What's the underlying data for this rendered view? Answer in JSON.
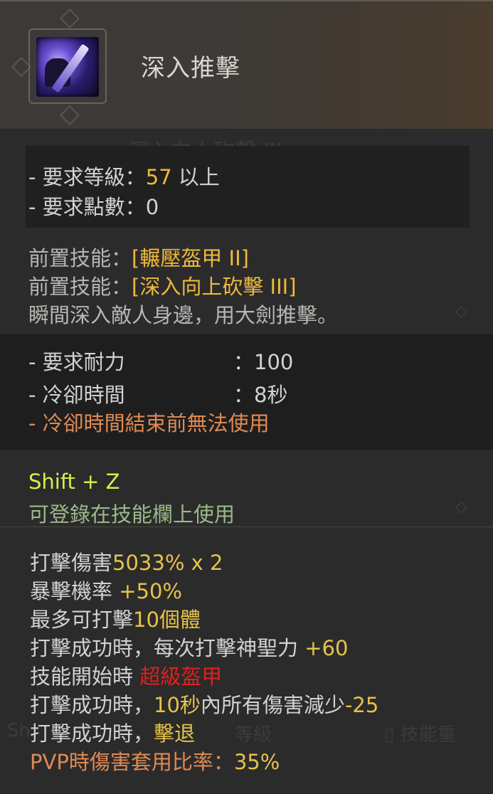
{
  "skill": {
    "name": "深入推擊",
    "icon": "skill-icon-greatsword-thrust"
  },
  "background_ghost": {
    "prev_skill": "深入向上砍擊 III",
    "bottom_left": "Sh",
    "bottom_mid": "等級",
    "bottom_right": "技能重"
  },
  "requirements": {
    "level_label": "- 要求等級：",
    "level_value": "57",
    "level_suffix": " 以上",
    "points_label": "- 要求點數：",
    "points_value": "0"
  },
  "prerequisites": {
    "label1": "前置技能：",
    "skill1": "[輾壓盔甲 II]",
    "label2": "前置技能：",
    "skill2": "[深入向上砍擊 III]",
    "description": "瞬間深入敵人身邊，用大劍推擊。"
  },
  "costs": {
    "stamina_label": "- 要求耐力",
    "stamina_value": "：100",
    "cooldown_label": "- 冷卻時間",
    "cooldown_value": "：8秒",
    "cooldown_note": "- 冷卻時間結束前無法使用"
  },
  "hotkey": {
    "keys": "Shift + Z",
    "note": "可登錄在技能欄上使用"
  },
  "effects": [
    {
      "label": "打擊傷害",
      "value": "5033% x 2",
      "value_class": "yellow"
    },
    {
      "label": "暴擊機率 ",
      "value": "+50%",
      "value_class": "yellow"
    },
    {
      "label": "最多可打擊",
      "value": "10個體",
      "value_class": "yellow"
    },
    {
      "label": "打擊成功時，每次打擊神聖力 ",
      "value": "+60",
      "value_class": "yellow"
    },
    {
      "label": "技能開始時 ",
      "value": "超級盔甲",
      "value_class": "red"
    },
    {
      "label": "打擊成功時，",
      "value": "10秒",
      "value_class": "yellow",
      "extra": "內所有傷害減少",
      "extra_value": "-25"
    },
    {
      "label": "打擊成功時，",
      "value": "擊退",
      "value_class": "yellow"
    }
  ],
  "pvp": {
    "label": "PVP時傷害套用比率：",
    "value": "35%"
  },
  "colors": {
    "accent_gold": "#f0b93a",
    "warning_orange": "#e08a54",
    "super_armor_red": "#e0201c",
    "hotkey_lime": "#d6ee4a",
    "note_green": "#9cb98a"
  }
}
